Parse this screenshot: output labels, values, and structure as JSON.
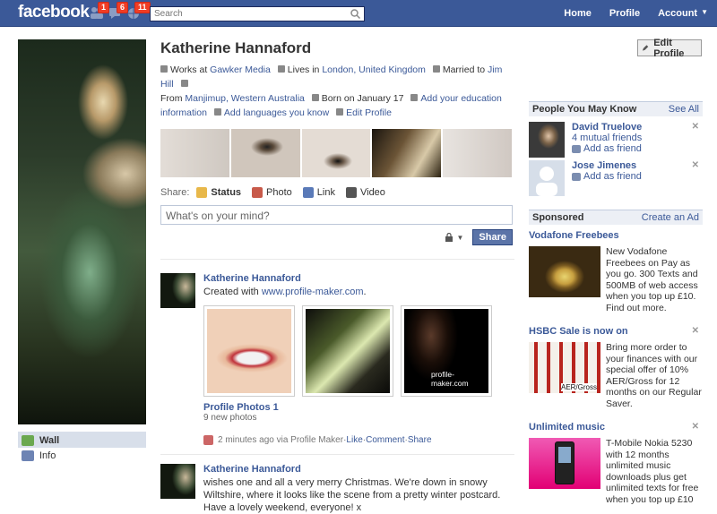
{
  "topbar": {
    "logo": "facebook",
    "badges": {
      "friend_requests": "1",
      "messages": "6",
      "notifications": "11"
    },
    "search_placeholder": "Search",
    "nav": {
      "home": "Home",
      "profile": "Profile",
      "account": "Account"
    }
  },
  "leftnav": {
    "items": [
      {
        "label": "Wall"
      },
      {
        "label": "Info"
      }
    ]
  },
  "profile": {
    "name": "Katherine Hannaford",
    "works_prefix": "Works at",
    "works_at": "Gawker Media",
    "lives_prefix": "Lives in",
    "lives_in": "London, United Kingdom",
    "married_prefix": "Married to",
    "married_to": "Jim Hill",
    "from_prefix": "From",
    "from": "Manjimup, Western Australia",
    "born": "Born on January 17",
    "add_education": "Add your education information",
    "add_languages": "Add languages you know",
    "edit_profile_link": "Edit Profile",
    "edit_profile_button": "Edit Profile"
  },
  "share": {
    "label": "Share:",
    "options": {
      "status": "Status",
      "photo": "Photo",
      "link": "Link",
      "video": "Video"
    },
    "placeholder": "What's on your mind?",
    "button": "Share"
  },
  "stories": [
    {
      "author": "Katherine Hannaford",
      "text_prefix": "Created with",
      "text_link": "www.profile-maker.com",
      "text_suffix": ".",
      "thumb_caption": "profile-maker.com",
      "album_title": "Profile Photos 1",
      "album_sub": "9 new photos",
      "meta_time": "2 minutes ago via Profile Maker",
      "meta_sep": " · ",
      "like": "Like",
      "comment": "Comment",
      "share": "Share"
    },
    {
      "author": "Katherine Hannaford",
      "text": "wishes one and all a very merry Christmas. We're down in snowy Wiltshire, where it looks like the scene from a pretty winter postcard. Have a lovely weekend, everyone! x"
    }
  ],
  "pymk": {
    "title": "People You May Know",
    "see_all": "See All",
    "people": [
      {
        "name": "David Truelove",
        "mutual": "4 mutual friends",
        "add": "Add as friend"
      },
      {
        "name": "Jose Jimenes",
        "add": "Add as friend"
      }
    ]
  },
  "sponsored": {
    "title": "Sponsored",
    "create_ad": "Create an Ad",
    "ads": [
      {
        "title": "Vodafone Freebees",
        "text": "New Vodafone Freebees on Pay as you go. 300 Texts and 500MB of web access when you top up £10. Find out more."
      },
      {
        "title": "HSBC Sale is now on",
        "text": "Bring more order to your finances with our special offer of 10% AER/Gross for 12 months on our Regular Saver.",
        "img_caption": "AER/Gross"
      },
      {
        "title": "Unlimited music",
        "text": "T-Mobile Nokia 5230 with 12 months unlimited music downloads plus get unlimited texts for free when you top up £10"
      }
    ]
  },
  "colors": {
    "brand": "#3b5998",
    "badge": "#f03d25",
    "link": "#3b5998"
  },
  "icons": [
    "friends-icon",
    "messages-icon",
    "globe-icon",
    "search-icon",
    "pencil-icon",
    "lock-icon",
    "close-icon",
    "add-friend-icon",
    "wall-icon",
    "info-icon"
  ]
}
